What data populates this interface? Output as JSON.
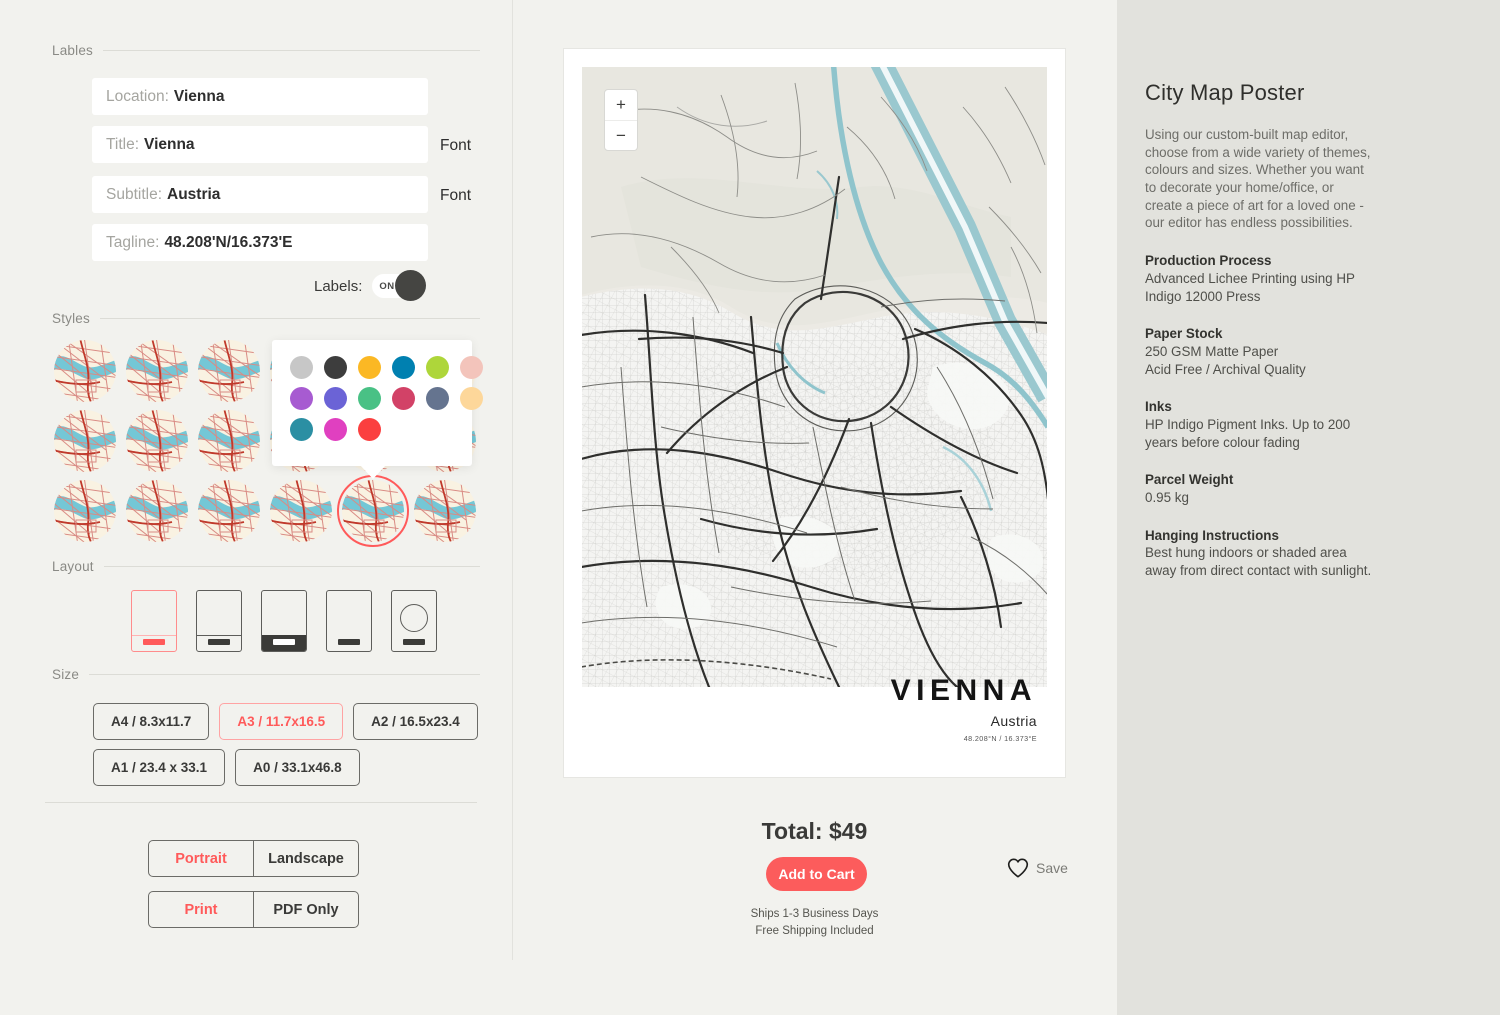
{
  "sections": {
    "labels_heading": "Lables",
    "styles_heading": "Styles",
    "layout_heading": "Layout",
    "size_heading": "Size"
  },
  "fields": [
    {
      "key": "Location:",
      "value": "Vienna",
      "name": "location-field",
      "font_button": null
    },
    {
      "key": "Title:",
      "value": "Vienna",
      "name": "title-field",
      "font_button": "Font"
    },
    {
      "key": "Subtitle:",
      "value": "Austria",
      "name": "subtitle-field",
      "font_button": "Font"
    },
    {
      "key": "Tagline:",
      "value": "48.208'N/16.373'E",
      "name": "tagline-field",
      "font_button": null
    }
  ],
  "labels_toggle": {
    "label": "Labels:",
    "state": "ON"
  },
  "color_swatches": [
    [
      "#c7c7c7",
      "#3d3d3d",
      "#fbb824",
      "#0080b0",
      "#aed63a",
      "#f3c4bb"
    ],
    [
      "#a75bd1",
      "#6b63d6",
      "#49c185",
      "#d24267",
      "#65748f",
      "#fdd79a"
    ],
    [
      "#2b8fa3",
      "#e040c0",
      "#fb3f3f"
    ]
  ],
  "styles": {
    "columns": 6,
    "rows": 3,
    "selected_index": 16
  },
  "layouts": [
    {
      "name": "layout-portrait-footer-red",
      "selected": true
    },
    {
      "name": "layout-portrait-footer-light",
      "selected": false
    },
    {
      "name": "layout-portrait-footer-dark",
      "selected": false
    },
    {
      "name": "layout-portrait-plain",
      "selected": false
    },
    {
      "name": "layout-portrait-circle",
      "selected": false
    }
  ],
  "sizes": [
    {
      "label": "A4 / 8.3x11.7",
      "selected": false
    },
    {
      "label": "A3 / 11.7x16.5",
      "selected": true
    },
    {
      "label": "A2 / 16.5x23.4",
      "selected": false
    },
    {
      "label": "A1 / 23.4 x 33.1",
      "selected": false
    },
    {
      "label": "A0 / 33.1x46.8",
      "selected": false
    }
  ],
  "orientation": {
    "options": [
      "Portrait",
      "Landscape"
    ],
    "selected": "Portrait"
  },
  "output": {
    "options": [
      "Print",
      "PDF Only"
    ],
    "selected": "Print"
  },
  "map": {
    "zoom_in": "+",
    "zoom_out": "−"
  },
  "poster": {
    "title": "VIENNA",
    "subtitle": "Austria",
    "coordinates": "48.208°N / 16.373°E"
  },
  "checkout": {
    "total": "Total: $49",
    "add_to_cart": "Add to Cart",
    "save": "Save",
    "shipping_line1": "Ships 1-3 Business Days",
    "shipping_line2": "Free Shipping Included"
  },
  "info": {
    "title": "City Map Poster",
    "description": "Using our custom-built map editor, choose from a wide variety of themes, colours and sizes. Whether you want to decorate your home/office, or create a piece of art for a loved one - our editor has endless possibilities.",
    "blocks": [
      {
        "heading": "Production Process",
        "body": "Advanced Lichee Printing using HP Indigo 12000 Press"
      },
      {
        "heading": "Paper Stock",
        "body": "250 GSM Matte Paper\nAcid Free / Archival Quality"
      },
      {
        "heading": "Inks",
        "body": "HP Indigo Pigment Inks. Up to 200 years before colour fading"
      },
      {
        "heading": "Parcel Weight",
        "body": "0.95 kg"
      },
      {
        "heading": "Hanging Instructions",
        "body": "Best hung indoors or shaded area away from direct contact with sunlight."
      }
    ]
  },
  "colors": {
    "accent": "#fc5c5c",
    "background": "#f2f2ee",
    "water": "#8fc4cc",
    "thumb_road": "#c0392b"
  }
}
